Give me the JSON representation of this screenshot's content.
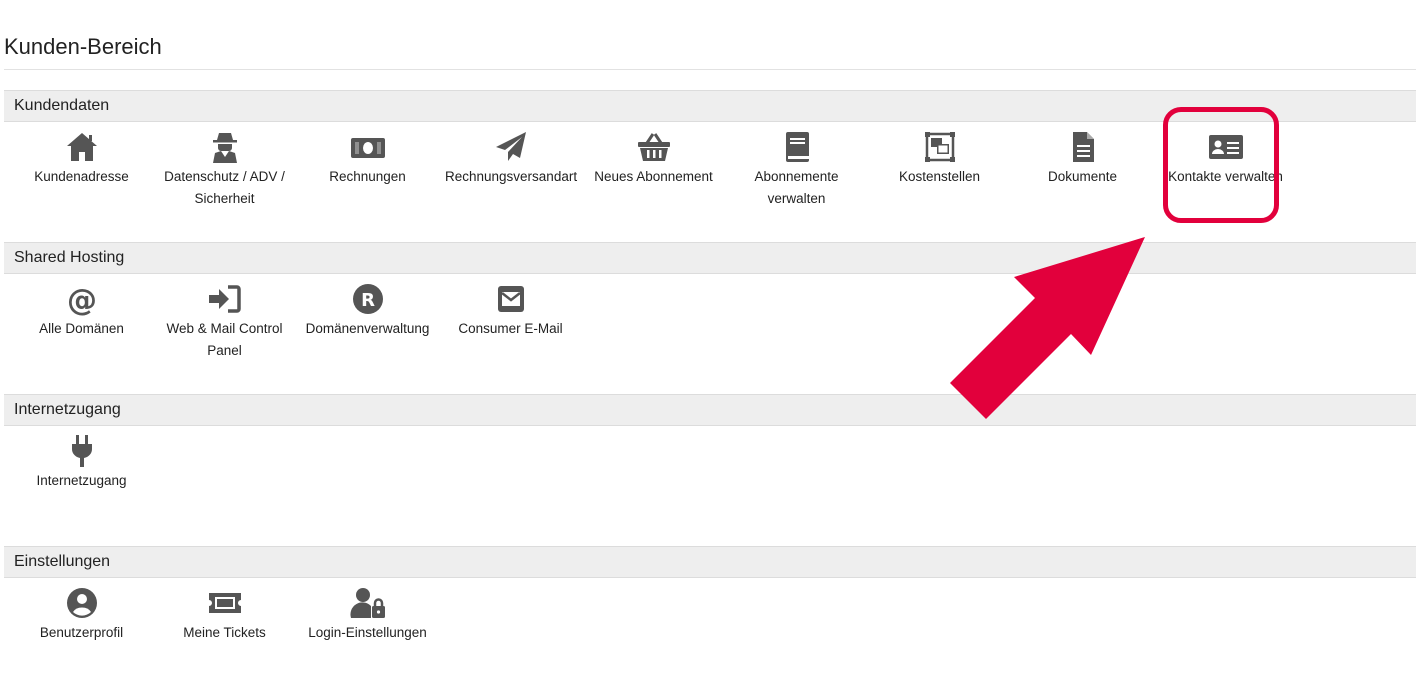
{
  "page_title": "Kunden-Bereich",
  "accent_color": "#e2003c",
  "icon_color": "#555555",
  "sections": [
    {
      "title": "Kundendaten",
      "items": [
        {
          "label": "Kundenadresse",
          "icon": "home-icon"
        },
        {
          "label": "Datenschutz / ADV / Sicherheit",
          "icon": "spy-icon"
        },
        {
          "label": "Rechnungen",
          "icon": "money-bill-icon"
        },
        {
          "label": "Rechnungsversandart",
          "icon": "paper-plane-icon"
        },
        {
          "label": "Neues Abonnement",
          "icon": "shopping-basket-icon"
        },
        {
          "label": "Abonnemente verwalten",
          "icon": "book-icon"
        },
        {
          "label": "Kostenstellen",
          "icon": "object-group-icon"
        },
        {
          "label": "Dokumente",
          "icon": "file-text-icon"
        },
        {
          "label": "Kontakte verwalten",
          "icon": "id-card-icon"
        }
      ]
    },
    {
      "title": "Shared Hosting",
      "items": [
        {
          "label": "Alle Domänen",
          "icon": "at-icon"
        },
        {
          "label": "Web & Mail Control Panel",
          "icon": "sign-in-icon"
        },
        {
          "label": "Domänenverwaltung",
          "icon": "registered-icon"
        },
        {
          "label": "Consumer E-Mail",
          "icon": "envelope-icon"
        }
      ]
    },
    {
      "title": "Internetzugang",
      "items": [
        {
          "label": "Internetzugang",
          "icon": "plug-icon"
        }
      ]
    },
    {
      "title": "Einstellungen",
      "items": [
        {
          "label": "Benutzerprofil",
          "icon": "user-circle-icon"
        },
        {
          "label": "Meine Tickets",
          "icon": "ticket-icon"
        },
        {
          "label": "Login-Einstellungen",
          "icon": "user-lock-icon"
        }
      ]
    }
  ]
}
